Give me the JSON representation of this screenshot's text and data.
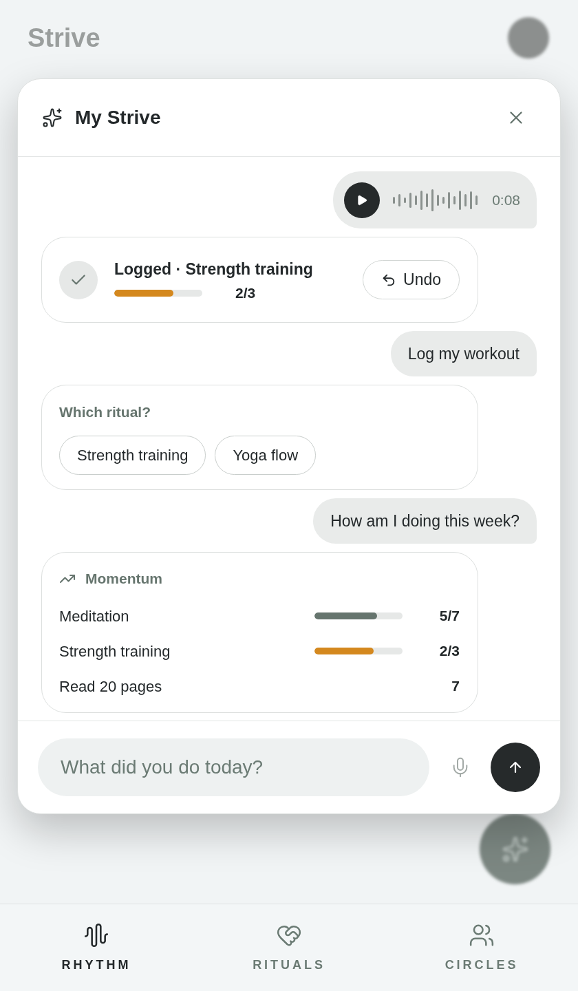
{
  "app": {
    "title": "Strive"
  },
  "assistant": {
    "title": "My Strive"
  },
  "messages": [
    {
      "kind": "voice",
      "duration": "0:08"
    },
    {
      "kind": "logged",
      "title": "Logged · Strength training",
      "level": 0.67,
      "count": "2/3",
      "action": "Undo"
    },
    {
      "kind": "text",
      "text": "Log my workout"
    },
    {
      "kind": "choice",
      "prompt": "Which ritual?",
      "options": [
        {
          "label": "Strength training"
        },
        {
          "label": "Yoga flow"
        }
      ]
    },
    {
      "kind": "text",
      "text": "How am I doing this week?"
    },
    {
      "kind": "momentum",
      "title": "Momentum",
      "rows": [
        {
          "kind": "bar",
          "name": "Meditation",
          "level": 0.71,
          "color": "#66756e",
          "reading": "5/7"
        },
        {
          "kind": "bar",
          "name": "Strength training",
          "level": 0.67,
          "color": "#d4881e",
          "reading": "2/3"
        },
        {
          "kind": "count",
          "name": "Read 20 pages",
          "reading": "7"
        }
      ]
    }
  ],
  "composer": {
    "placeholder": "What did you do today?"
  },
  "tabs": [
    {
      "label": "RHYTHM",
      "selected": true
    },
    {
      "label": "RITUALS",
      "selected": false
    },
    {
      "label": "CIRCLES",
      "selected": false
    }
  ]
}
